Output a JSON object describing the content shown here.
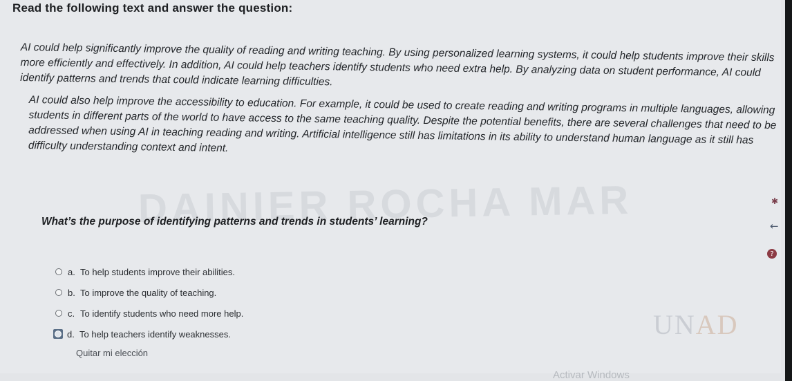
{
  "instruction": "Read the following text and answer the question:",
  "passage": {
    "paragraph1": "AI could help significantly improve the quality of reading and writing teaching. By using personalized learning systems, it could help students improve their skills more efficiently and effectively. In addition, AI could help teachers identify students who need extra help. By analyzing data on student performance, AI could identify patterns and trends that could indicate learning difficulties.",
    "paragraph2": "AI could also help improve the accessibility to education. For example, it could be used to create reading and writing programs in multiple languages, allowing students in different parts of the world to have access to the same teaching quality. Despite the potential benefits, there are several challenges that need to be addressed when using AI in teaching reading and writing. Artificial intelligence still has limitations in its ability to understand human language as it still has difficulty understanding context and intent."
  },
  "question": "What’s the purpose of identifying patterns and trends in students’ learning?",
  "options": [
    {
      "letter": "a.",
      "text": "To help students improve their abilities."
    },
    {
      "letter": "b.",
      "text": "To improve the quality of teaching."
    },
    {
      "letter": "c.",
      "text": "To identify students who need more help."
    },
    {
      "letter": "d.",
      "text": "To help teachers identify weaknesses."
    }
  ],
  "clear_choice": "Quitar mi elección",
  "watermark_text": "DAINIER ROCHA MAR",
  "logo_text": {
    "main": "UN",
    "accent": "AD"
  },
  "os_overlay": "Activar Windows",
  "icons": {
    "pin": "pin-icon",
    "back": "back-arrow-icon",
    "help": "help-icon"
  },
  "colors": {
    "help_badge": "#8c3b44",
    "focus_highlight": "#5a6e86"
  }
}
